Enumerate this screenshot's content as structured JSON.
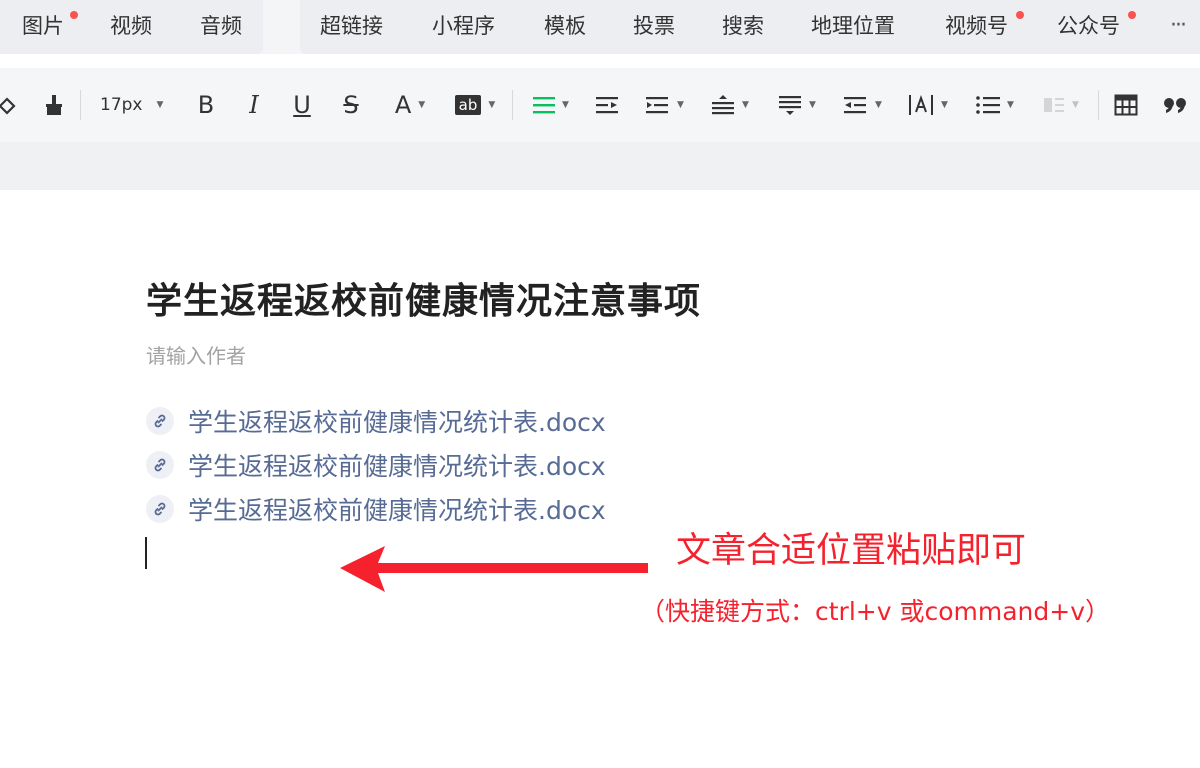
{
  "insert_bar": {
    "items": [
      {
        "label": "图片",
        "badge": true
      },
      {
        "label": "视频",
        "badge": false
      },
      {
        "label": "音频",
        "badge": false
      },
      {
        "label": "超链接",
        "badge": false
      },
      {
        "label": "小程序",
        "badge": false
      },
      {
        "label": "模板",
        "badge": false
      },
      {
        "label": "投票",
        "badge": false
      },
      {
        "label": "搜索",
        "badge": false
      },
      {
        "label": "地理位置",
        "badge": false
      },
      {
        "label": "视频号",
        "badge": true
      },
      {
        "label": "公众号",
        "badge": true
      }
    ],
    "more": "···"
  },
  "toolbar": {
    "font_size": "17px",
    "bold": "B",
    "italic": "I",
    "underline": "U",
    "strike": "S",
    "font_color": "A",
    "bg_color": "ab",
    "icons": [
      "eraser-icon",
      "format-brush-icon",
      "align-icon",
      "indent-icon",
      "first-line-indent-icon",
      "line-height-icon",
      "paragraph-spacing-icon",
      "outdent-icon",
      "letter-spacing-icon",
      "list-icon",
      "column-icon",
      "table-icon",
      "quote-icon"
    ],
    "accent_color": "#07c160"
  },
  "document": {
    "title": "学生返程返校前健康情况注意事项",
    "author_placeholder": "请输入作者",
    "attachments": [
      "学生返程返校前健康情况统计表.docx",
      "学生返程返校前健康情况统计表.docx",
      "学生返程返校前健康情况统计表.docx"
    ]
  },
  "annotation": {
    "main": "文章合适位置粘贴即可",
    "sub": "（快捷键方式：ctrl+v 或command+v）",
    "color": "#f5222d"
  }
}
